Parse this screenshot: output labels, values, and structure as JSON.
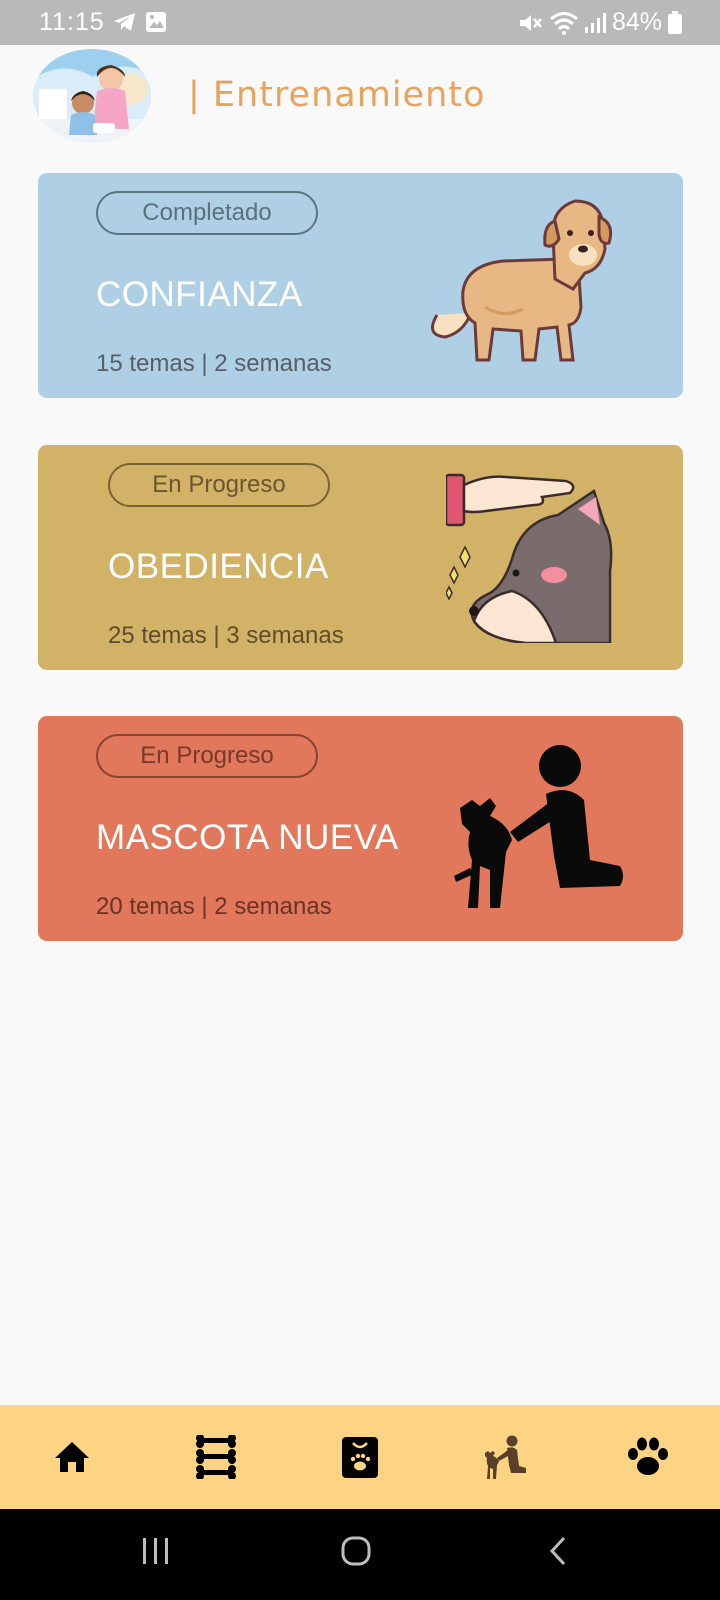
{
  "status_bar": {
    "time": "11:15",
    "battery": "84%",
    "icons": [
      "telegram-icon",
      "gallery-icon",
      "mute-icon",
      "wifi-icon",
      "signal-icon",
      "battery-icon"
    ]
  },
  "header": {
    "title": "| Entrenamiento"
  },
  "courses": [
    {
      "badge": "Completado",
      "title": "CONFIANZA",
      "meta": "15 temas | 2 semanas",
      "color": "#afd0e4"
    },
    {
      "badge": "En Progreso",
      "title": "OBEDIENCIA",
      "meta": "25 temas | 3 semanas",
      "color": "#d2b266"
    },
    {
      "badge": "En Progreso",
      "title": "MASCOTA NUEVA",
      "meta": "20 temas | 2 semanas",
      "color": "#e1775b"
    }
  ],
  "bottom_nav": {
    "background": "#fdd384",
    "items": [
      "home-icon",
      "bones-icon",
      "training-icon",
      "dog-trainer-icon",
      "paw-icon"
    ]
  },
  "system_nav": [
    "recents-icon",
    "home-circle-icon",
    "back-icon"
  ]
}
